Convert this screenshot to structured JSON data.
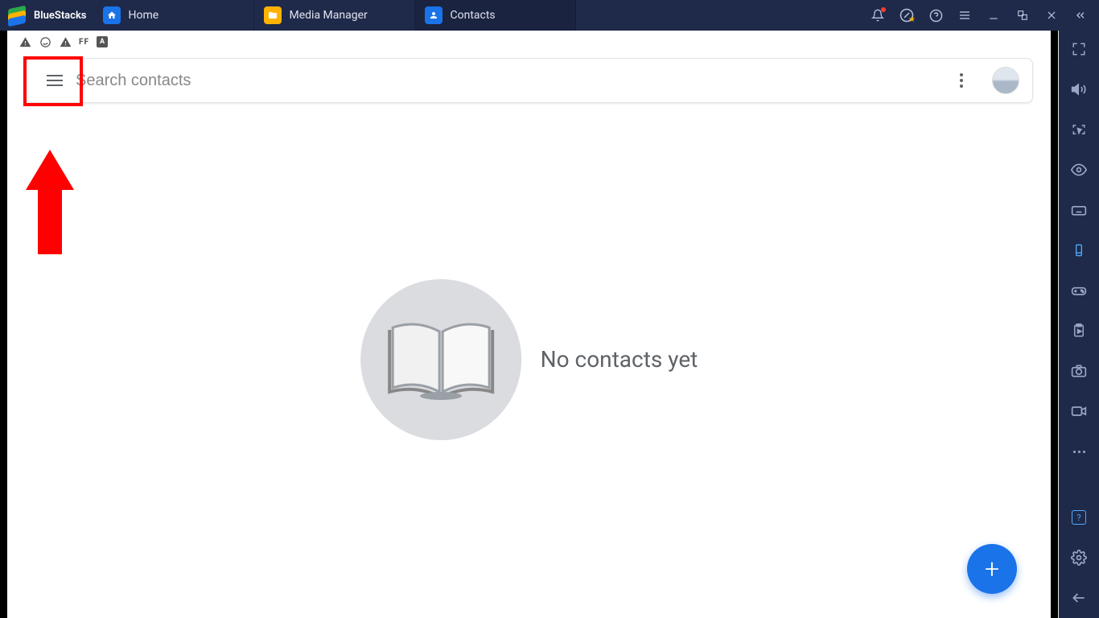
{
  "app": {
    "name": "BlueStacks"
  },
  "tabs": [
    {
      "label": "Home"
    },
    {
      "label": "Media Manager"
    },
    {
      "label": "Contacts"
    }
  ],
  "search": {
    "placeholder": "Search contacts"
  },
  "empty": {
    "message": "No contacts yet"
  },
  "statusbar": {
    "ff": "FF",
    "a": "A"
  }
}
